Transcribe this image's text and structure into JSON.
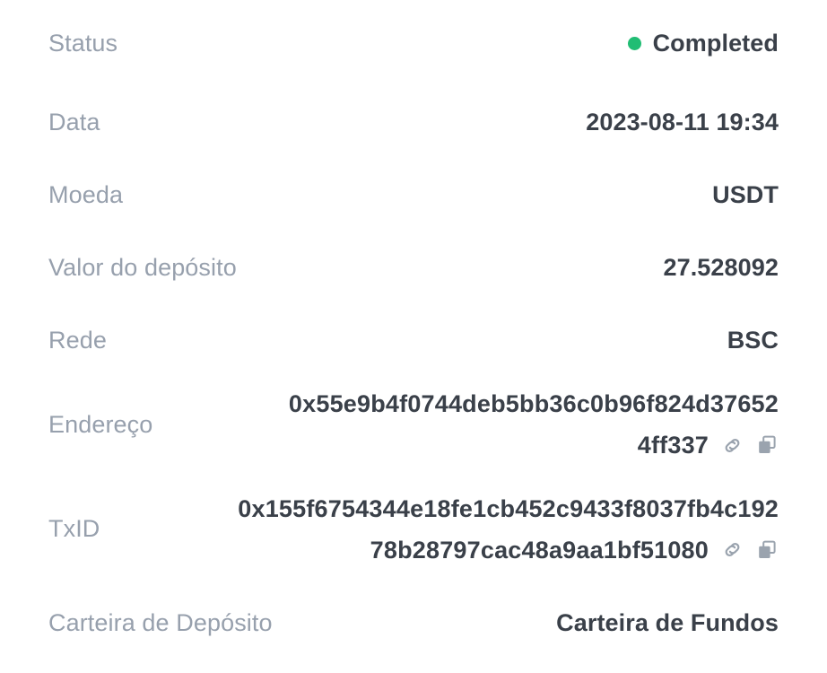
{
  "screen": {
    "kind": "deposit-detail-panel",
    "background_color": "#ffffff",
    "label_color": "#97a0ad",
    "value_color": "#3a4049",
    "accent_green": "#21bd74",
    "icon_color": "#9aa3ae"
  },
  "rows": {
    "status": {
      "label": "Status",
      "value": "Completed",
      "dot_color": "#21bd74",
      "dot_icon": "status-dot-icon"
    },
    "data": {
      "label": "Data",
      "value": "2023-08-11 19:34"
    },
    "moeda": {
      "label": "Moeda",
      "value": "USDT"
    },
    "valor": {
      "label": "Valor do depósito",
      "value": "27.528092"
    },
    "rede": {
      "label": "Rede",
      "value": "BSC"
    },
    "endereco": {
      "label": "Endereço",
      "line1": "0x55e9b4f0744deb5bb36c0b96f824d37652",
      "line2": "4ff337",
      "full_value": "0x55e9b4f0744deb5bb36c0b96f824d376524ff337",
      "link_icon": "link-icon",
      "copy_icon": "copy-icon"
    },
    "txid": {
      "label": "TxID",
      "line1": "0x155f6754344e18fe1cb452c9433f8037fb4c192",
      "line2": "78b28797cac48a9aa1bf51080",
      "full_value": "0x155f6754344e18fe1cb452c9433f8037fb4c19278b28797cac48a9aa1bf51080",
      "link_icon": "link-icon",
      "copy_icon": "copy-icon"
    },
    "carteira": {
      "label": "Carteira de Depósito",
      "value": "Carteira de Fundos"
    }
  }
}
